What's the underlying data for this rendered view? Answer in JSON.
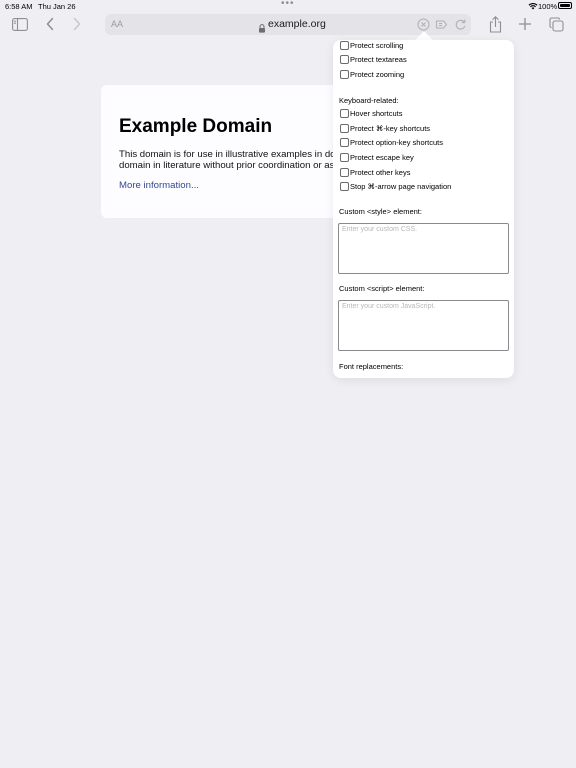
{
  "status_bar": {
    "time": "6:58 AM",
    "date": "Thu Jan 26",
    "multitask_dots": "•••",
    "battery_pct": "100%"
  },
  "toolbar": {
    "icons": [
      "sidebar-icon",
      "back-icon",
      "forward-icon",
      "share-icon",
      "plus-icon",
      "tabs-icon"
    ]
  },
  "address_bar": {
    "aa_label": "AA",
    "url": "example.org",
    "icons": [
      "lock-icon",
      "stop-icon",
      "extension-icon",
      "reload-icon"
    ]
  },
  "page": {
    "title": "Example Domain",
    "paragraph_line1": "This domain is for use in illustrative examples in docu",
    "paragraph_line2": "domain in literature without prior coordination or aski",
    "link": "More information..."
  },
  "popover": {
    "top_options": [
      {
        "label": "Protect scrolling",
        "checked": false
      },
      {
        "label": "Protect textareas",
        "checked": false
      },
      {
        "label": "Protect zooming",
        "checked": false
      }
    ],
    "keyboard_heading": "Keyboard-related:",
    "keyboard_options": [
      {
        "label": "Hover shortcuts",
        "checked": false
      },
      {
        "label": "Protect ⌘-key shortcuts",
        "checked": false
      },
      {
        "label": "Protect option-key shortcuts",
        "checked": false
      },
      {
        "label": "Protect escape key",
        "checked": false
      },
      {
        "label": "Protect other keys",
        "checked": false
      },
      {
        "label": "Stop ⌘-arrow page navigation",
        "checked": false
      }
    ],
    "style_label": "Custom <style> element:",
    "style_placeholder": "Enter your custom CSS.",
    "script_label": "Custom <script> element:",
    "script_placeholder": "Enter your custom JavaScript.",
    "font_label": "Font replacements:"
  },
  "colors": {
    "background": "#efeff3",
    "link": "#38488f",
    "toolbar_icon": "#8e8e93"
  }
}
